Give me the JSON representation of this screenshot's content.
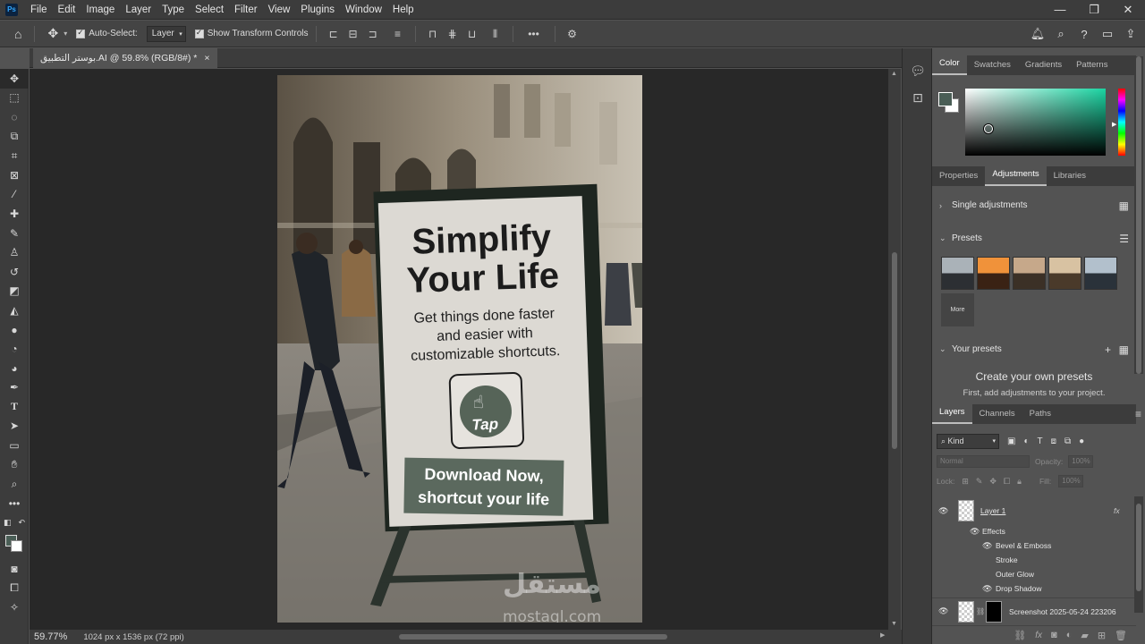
{
  "menubar": {
    "app_icon": "Ps",
    "items": [
      "File",
      "Edit",
      "Image",
      "Layer",
      "Type",
      "Select",
      "Filter",
      "View",
      "Plugins",
      "Window",
      "Help"
    ],
    "window_controls": [
      "—",
      "❐",
      "✕"
    ]
  },
  "options": {
    "auto_select_label": "Auto-Select:",
    "auto_select_value": "Layer",
    "show_transform_label": "Show Transform Controls",
    "more_label": "•••"
  },
  "document": {
    "tab_title": "بوستر التطبيق.AI @ 59.8% (RGB/8#) *",
    "tab_close": "×"
  },
  "status": {
    "zoom": "59.77%",
    "doc_info": "1024 px x 1536 px (72 ppi)"
  },
  "poster": {
    "headline_1": "Simplify",
    "headline_2": "Your Life",
    "sub_1": "Get things done faster",
    "sub_2": "and easier with",
    "sub_3": "customizable shortcuts.",
    "logo_text": "Tap",
    "cta_1": "Download Now,",
    "cta_2": "shortcut your life",
    "watermark_ar": "مستقل",
    "watermark_en": "mostaql.com"
  },
  "color_panel": {
    "tabs": [
      "Color",
      "Swatches",
      "Gradients",
      "Patterns"
    ],
    "foreground": "#4a5e56",
    "background": "#ffffff"
  },
  "adjust_panel": {
    "tabs": [
      "Properties",
      "Adjustments",
      "Libraries"
    ],
    "single_adjustments": "Single adjustments",
    "presets": "Presets",
    "more": "More",
    "your_presets": "Your presets",
    "create_title": "Create your own presets",
    "create_sub": "First, add adjustments to your project."
  },
  "layers_panel": {
    "tabs": [
      "Layers",
      "Channels",
      "Paths"
    ],
    "kind": "Kind",
    "blend_mode": "Normal",
    "opacity_label": "Opacity:",
    "opacity_value": "100%",
    "lock_label": "Lock:",
    "fill_label": "Fill:",
    "fill_value": "100%",
    "layer1_name": "Layer 1",
    "fx_label": "fx",
    "effects_label": "Effects",
    "effects": [
      "Bevel & Emboss",
      "Stroke",
      "Outer Glow",
      "Drop Shadow"
    ],
    "layer2_name": "Screenshot 2025-05-24 223206"
  }
}
